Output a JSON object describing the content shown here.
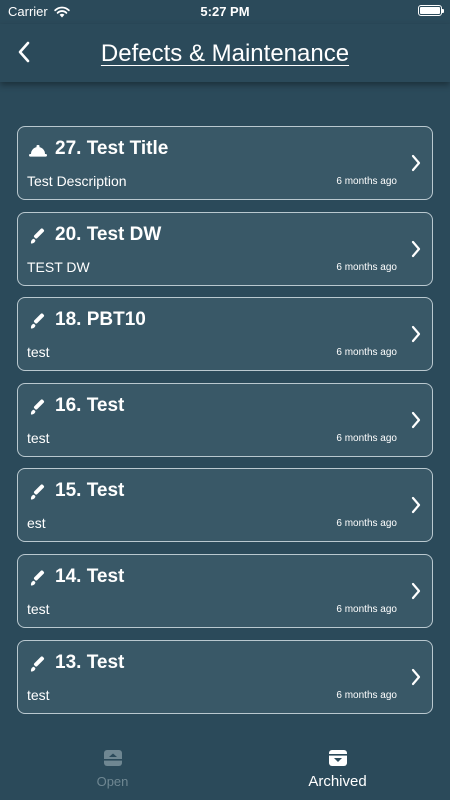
{
  "status_bar": {
    "carrier": "Carrier",
    "time": "5:27 PM"
  },
  "header": {
    "title": "Defects & Maintenance"
  },
  "items": [
    {
      "icon": "hard-hat-icon",
      "title": "27. Test Title",
      "description": "Test Description",
      "time": "6 months ago"
    },
    {
      "icon": "brush-icon",
      "title": "20. Test DW",
      "description": "TEST DW",
      "time": "6 months ago"
    },
    {
      "icon": "brush-icon",
      "title": "18. PBT10",
      "description": "test",
      "time": "6 months ago"
    },
    {
      "icon": "brush-icon",
      "title": "16. Test",
      "description": "test",
      "time": "6 months ago"
    },
    {
      "icon": "brush-icon",
      "title": "15. Test",
      "description": "est",
      "time": "6 months ago"
    },
    {
      "icon": "brush-icon",
      "title": "14. Test",
      "description": "test",
      "time": "6 months ago"
    },
    {
      "icon": "brush-icon",
      "title": "13. Test",
      "description": "test",
      "time": "6 months ago"
    }
  ],
  "tabs": [
    {
      "label": "Open",
      "icon": "inbox-up-icon",
      "active": false
    },
    {
      "label": "Archived",
      "icon": "archive-down-icon",
      "active": true
    }
  ],
  "colors": {
    "background": "#2b4a5a",
    "card": "#395867",
    "card_border": "#b9c8cf",
    "inactive_tab": "#6f8792"
  }
}
